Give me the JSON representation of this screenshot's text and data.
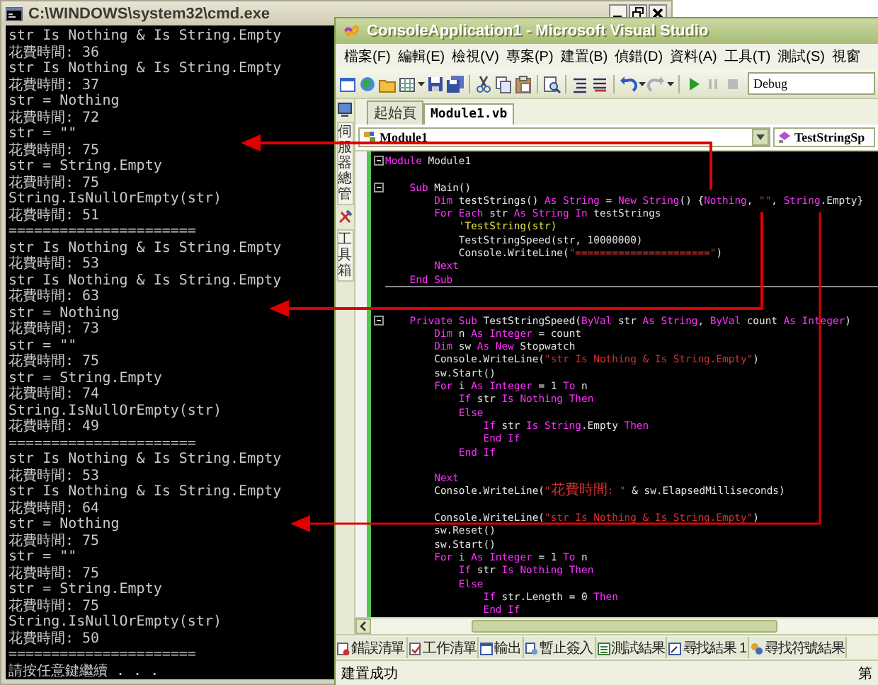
{
  "cmd_window": {
    "title": "C:\\WINDOWS\\system32\\cmd.exe",
    "lines": [
      "str Is Nothing & Is String.Empty",
      "花費時間: 36",
      "str Is Nothing & Is String.Empty",
      "花費時間: 37",
      "str = Nothing",
      "花費時間: 72",
      "str = \"\"",
      "花費時間: 75",
      "str = String.Empty",
      "花費時間: 75",
      "String.IsNullOrEmpty(str)",
      "花費時間: 51",
      "======================",
      "str Is Nothing & Is String.Empty",
      "花費時間: 53",
      "str Is Nothing & Is String.Empty",
      "花費時間: 63",
      "str = Nothing",
      "花費時間: 73",
      "str = \"\"",
      "花費時間: 75",
      "str = String.Empty",
      "花費時間: 74",
      "String.IsNullOrEmpty(str)",
      "花費時間: 49",
      "======================",
      "str Is Nothing & Is String.Empty",
      "花費時間: 53",
      "str Is Nothing & Is String.Empty",
      "花費時間: 64",
      "str = Nothing",
      "花費時間: 75",
      "str = \"\"",
      "花費時間: 75",
      "str = String.Empty",
      "花費時間: 75",
      "String.IsNullOrEmpty(str)",
      "花費時間: 50",
      "======================",
      "請按任意鍵繼續 . . ."
    ]
  },
  "vs_window": {
    "title": "ConsoleApplication1 - Microsoft Visual Studio",
    "menu": [
      "檔案(F)",
      "編輯(E)",
      "檢視(V)",
      "專案(P)",
      "建置(B)",
      "偵錯(D)",
      "資料(A)",
      "工具(T)",
      "測試(S)",
      "視窗"
    ],
    "toolbar": {
      "configuration": "Debug"
    },
    "side_tabs": [
      "伺服器總管",
      "工具箱"
    ],
    "document_tabs": [
      {
        "label": "起始頁",
        "selected": false
      },
      {
        "label": "Module1.vb",
        "selected": true
      }
    ],
    "navigation": {
      "type_combo": "Module1",
      "member_combo": "TestStringSp"
    },
    "code_lines": [
      {
        "kind": "code",
        "fold": true,
        "tokens": [
          {
            "kind": "keyword",
            "text": "Module"
          },
          {
            "kind": "plain",
            "text": " Module1"
          }
        ]
      },
      {
        "kind": "blank"
      },
      {
        "kind": "code",
        "fold": true,
        "tokens": [
          {
            "kind": "keyword",
            "text": "    Sub"
          },
          {
            "kind": "plain",
            "text": " Main()"
          }
        ]
      },
      {
        "kind": "code",
        "fold": false,
        "tokens": [
          {
            "kind": "keyword",
            "text": "        Dim"
          },
          {
            "kind": "plain",
            "text": " testStrings() "
          },
          {
            "kind": "keyword",
            "text": "As String"
          },
          {
            "kind": "plain",
            "text": " = "
          },
          {
            "kind": "keyword",
            "text": "New String"
          },
          {
            "kind": "plain",
            "text": "() {"
          },
          {
            "kind": "keyword",
            "text": "Nothing"
          },
          {
            "kind": "plain",
            "text": ", "
          },
          {
            "kind": "string",
            "text": "\"\""
          },
          {
            "kind": "plain",
            "text": ", "
          },
          {
            "kind": "keyword",
            "text": "String"
          },
          {
            "kind": "plain",
            "text": ".Empty}"
          }
        ]
      },
      {
        "kind": "code",
        "fold": false,
        "tokens": [
          {
            "kind": "keyword",
            "text": "        For Each"
          },
          {
            "kind": "plain",
            "text": " str "
          },
          {
            "kind": "keyword",
            "text": "As String In"
          },
          {
            "kind": "plain",
            "text": " testStrings"
          }
        ]
      },
      {
        "kind": "code",
        "fold": false,
        "tokens": [
          {
            "kind": "comment",
            "text": "            'TestString(str)"
          }
        ]
      },
      {
        "kind": "code",
        "fold": false,
        "tokens": [
          {
            "kind": "plain",
            "text": "            TestStringSpeed(str, 10000000)"
          }
        ]
      },
      {
        "kind": "code",
        "fold": false,
        "tokens": [
          {
            "kind": "plain",
            "text": "            Console.WriteLine("
          },
          {
            "kind": "string",
            "text": "\"======================\""
          },
          {
            "kind": "plain",
            "text": ")"
          }
        ]
      },
      {
        "kind": "code",
        "fold": false,
        "tokens": [
          {
            "kind": "keyword",
            "text": "        Next"
          }
        ]
      },
      {
        "kind": "code",
        "fold": false,
        "tokens": [
          {
            "kind": "keyword",
            "text": "    End Sub"
          }
        ]
      },
      {
        "kind": "divider"
      },
      {
        "kind": "blank"
      },
      {
        "kind": "code",
        "fold": true,
        "tokens": [
          {
            "kind": "keyword",
            "text": "    Private Sub"
          },
          {
            "kind": "plain",
            "text": " TestStringSpeed("
          },
          {
            "kind": "keyword",
            "text": "ByVal"
          },
          {
            "kind": "plain",
            "text": " str "
          },
          {
            "kind": "keyword",
            "text": "As String"
          },
          {
            "kind": "plain",
            "text": ", "
          },
          {
            "kind": "keyword",
            "text": "ByVal"
          },
          {
            "kind": "plain",
            "text": " count "
          },
          {
            "kind": "keyword",
            "text": "As Integer"
          },
          {
            "kind": "plain",
            "text": ")"
          }
        ]
      },
      {
        "kind": "code",
        "fold": false,
        "tokens": [
          {
            "kind": "keyword",
            "text": "        Dim"
          },
          {
            "kind": "plain",
            "text": " n "
          },
          {
            "kind": "keyword",
            "text": "As Integer"
          },
          {
            "kind": "plain",
            "text": " = count"
          }
        ]
      },
      {
        "kind": "code",
        "fold": false,
        "tokens": [
          {
            "kind": "keyword",
            "text": "        Dim"
          },
          {
            "kind": "plain",
            "text": " sw "
          },
          {
            "kind": "keyword",
            "text": "As New"
          },
          {
            "kind": "plain",
            "text": " Stopwatch"
          }
        ]
      },
      {
        "kind": "code",
        "fold": false,
        "tokens": [
          {
            "kind": "plain",
            "text": "        Console.WriteLine("
          },
          {
            "kind": "string",
            "text": "\"str Is Nothing & Is String.Empty\""
          },
          {
            "kind": "plain",
            "text": ")"
          }
        ]
      },
      {
        "kind": "code",
        "fold": false,
        "tokens": [
          {
            "kind": "plain",
            "text": "        sw.Start()"
          }
        ]
      },
      {
        "kind": "code",
        "fold": false,
        "tokens": [
          {
            "kind": "keyword",
            "text": "        For"
          },
          {
            "kind": "plain",
            "text": " i "
          },
          {
            "kind": "keyword",
            "text": "As Integer"
          },
          {
            "kind": "plain",
            "text": " = 1 "
          },
          {
            "kind": "keyword",
            "text": "To"
          },
          {
            "kind": "plain",
            "text": " n"
          }
        ]
      },
      {
        "kind": "code",
        "fold": false,
        "tokens": [
          {
            "kind": "keyword",
            "text": "            If"
          },
          {
            "kind": "plain",
            "text": " str "
          },
          {
            "kind": "keyword",
            "text": "Is Nothing Then"
          }
        ]
      },
      {
        "kind": "code",
        "fold": false,
        "tokens": [
          {
            "kind": "keyword",
            "text": "            Else"
          }
        ]
      },
      {
        "kind": "code",
        "fold": false,
        "tokens": [
          {
            "kind": "keyword",
            "text": "                If"
          },
          {
            "kind": "plain",
            "text": " str "
          },
          {
            "kind": "keyword",
            "text": "Is String"
          },
          {
            "kind": "plain",
            "text": ".Empty "
          },
          {
            "kind": "keyword",
            "text": "Then"
          }
        ]
      },
      {
        "kind": "code",
        "fold": false,
        "tokens": [
          {
            "kind": "keyword",
            "text": "                End If"
          }
        ]
      },
      {
        "kind": "code",
        "fold": false,
        "tokens": [
          {
            "kind": "keyword",
            "text": "            End If"
          }
        ]
      },
      {
        "kind": "blank"
      },
      {
        "kind": "code",
        "fold": false,
        "tokens": [
          {
            "kind": "keyword",
            "text": "        Next"
          }
        ]
      },
      {
        "kind": "code",
        "fold": false,
        "tokens": [
          {
            "kind": "plain",
            "text": "        Console.WriteLine("
          },
          {
            "kind": "string",
            "text": "\"花費時間: \""
          },
          {
            "kind": "plain",
            "text": " & sw.ElapsedMilliseconds)"
          }
        ]
      },
      {
        "kind": "blank"
      },
      {
        "kind": "code",
        "fold": false,
        "tokens": [
          {
            "kind": "plain",
            "text": "        Console.WriteLine("
          },
          {
            "kind": "string",
            "text": "\"str Is Nothing & Is String.Empty\""
          },
          {
            "kind": "plain",
            "text": ")"
          }
        ]
      },
      {
        "kind": "code",
        "fold": false,
        "tokens": [
          {
            "kind": "plain",
            "text": "        sw.Reset()"
          }
        ]
      },
      {
        "kind": "code",
        "fold": false,
        "tokens": [
          {
            "kind": "plain",
            "text": "        sw.Start()"
          }
        ]
      },
      {
        "kind": "code",
        "fold": false,
        "tokens": [
          {
            "kind": "keyword",
            "text": "        For"
          },
          {
            "kind": "plain",
            "text": " i "
          },
          {
            "kind": "keyword",
            "text": "As Integer"
          },
          {
            "kind": "plain",
            "text": " = 1 "
          },
          {
            "kind": "keyword",
            "text": "To"
          },
          {
            "kind": "plain",
            "text": " n"
          }
        ]
      },
      {
        "kind": "code",
        "fold": false,
        "tokens": [
          {
            "kind": "keyword",
            "text": "            If"
          },
          {
            "kind": "plain",
            "text": " str "
          },
          {
            "kind": "keyword",
            "text": "Is Nothing Then"
          }
        ]
      },
      {
        "kind": "code",
        "fold": false,
        "tokens": [
          {
            "kind": "keyword",
            "text": "            Else"
          }
        ]
      },
      {
        "kind": "code",
        "fold": false,
        "tokens": [
          {
            "kind": "keyword",
            "text": "                If"
          },
          {
            "kind": "plain",
            "text": " str.Length = 0 "
          },
          {
            "kind": "keyword",
            "text": "Then"
          }
        ]
      },
      {
        "kind": "code",
        "fold": false,
        "tokens": [
          {
            "kind": "keyword",
            "text": "                End If"
          }
        ]
      }
    ],
    "tool_tabs": [
      "錯誤清單",
      "工作清單",
      "輸出",
      "暫止簽入",
      "測試結果",
      "尋找結果 1",
      "尋找符號結果"
    ],
    "status_bar": {
      "message": "建置成功",
      "column_2": "第"
    }
  }
}
